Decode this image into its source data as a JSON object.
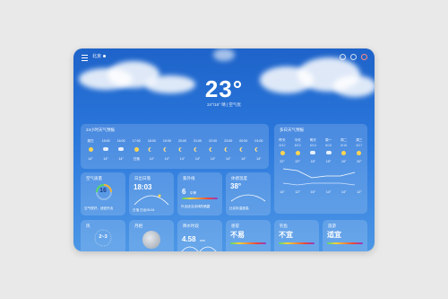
{
  "header": {
    "city": "北京"
  },
  "current": {
    "temperature": "23°",
    "subline": "24°/16°  晴 | 空气优"
  },
  "hourly": {
    "title": "24小时天气预报",
    "times": [
      "现在",
      "15:00",
      "16:00",
      "17:00",
      "18:00",
      "19:00",
      "20:00",
      "21:00",
      "22:00",
      "23:00",
      "00:00",
      "01:00"
    ],
    "icons": [
      "sun-icon",
      "cloudy-icon",
      "cloudy-icon",
      "sun-icon",
      "moon-icon",
      "moon-icon",
      "moon-icon",
      "moon-icon",
      "moon-icon",
      "moon-icon",
      "moon-icon",
      "moon-icon"
    ],
    "temps": [
      "14°",
      "14°",
      "14°",
      "日落",
      "14°",
      "14°",
      "14°",
      "14°",
      "14°",
      "14°",
      "14°",
      "14°"
    ]
  },
  "daily": {
    "title": "多日天气预报",
    "days": [
      "昨天",
      "今天",
      "明天",
      "周一",
      "周二",
      "周三"
    ],
    "dates": [
      "6/12",
      "6/13",
      "6/14",
      "6/15",
      "6/16",
      "6/17"
    ],
    "highs": [
      "22°",
      "22°",
      "18°",
      "19°",
      "19°",
      "20°"
    ],
    "lows": [
      "14°",
      "12°",
      "16°",
      "14°",
      "14°",
      "12°"
    ]
  },
  "cards_row1": {
    "aqi": {
      "title": "空气质量",
      "value": "16",
      "note": "空气很好，适宜外出"
    },
    "sunrise": {
      "title": "日出日落",
      "value": "18:03",
      "note": "日落  日出05:04"
    },
    "uv": {
      "title": "紫外线",
      "value": "6",
      "unit": "中等",
      "note": "外出适当涂抹防晒霜"
    },
    "feels": {
      "title": "体感温度",
      "value": "38°",
      "note": "比实际温度高"
    }
  },
  "cards_row2": {
    "wind": {
      "title": "风",
      "value": "2~3"
    },
    "moon": {
      "title": "月相"
    },
    "rain": {
      "title": "降水时段",
      "value": "4.58",
      "unit": "mm"
    },
    "cold": {
      "title": "感冒",
      "value": "不易"
    },
    "fishing": {
      "title": "钓鱼",
      "value": "不宜"
    },
    "travel": {
      "title": "旅游",
      "value": "适宜"
    }
  }
}
